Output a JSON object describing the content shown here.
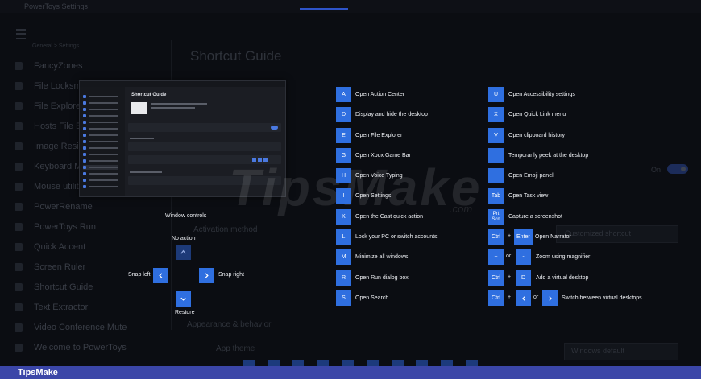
{
  "background": {
    "app_title": "PowerToys Settings",
    "breadcrumb": "General > Settings",
    "nav_items": [
      "FancyZones",
      "File Locksmith",
      "File Explorer add-ons",
      "Hosts File Editor",
      "Image Resizer",
      "Keyboard Manager",
      "Mouse utilities",
      "PowerRename",
      "PowerToys Run",
      "Quick Accent",
      "Screen Ruler",
      "Shortcut Guide",
      "Text Extractor",
      "Video Conference Mute",
      "Welcome to PowerToys"
    ],
    "page_title": "Shortcut Guide",
    "activation_heading": "Activation method",
    "dropdown_value": "Customized shortcut",
    "appearance_heading": "Appearance & behavior",
    "app_theme": "App theme",
    "theme_value": "Windows default",
    "toggle_label": "On"
  },
  "thumbnail": {
    "title": "Shortcut Guide"
  },
  "watermark": {
    "main": "TipsMake",
    "suffix": ".com"
  },
  "window_controls": {
    "heading": "Window controls",
    "no_action": "No action",
    "snap_left": "Snap left",
    "snap_right": "Snap right",
    "restore": "Restore"
  },
  "shortcuts_left": [
    {
      "key": "A",
      "label": "Open Action Center"
    },
    {
      "key": "D",
      "label": "Display and hide the desktop"
    },
    {
      "key": "E",
      "label": "Open File Explorer"
    },
    {
      "key": "G",
      "label": "Open Xbox Game Bar"
    },
    {
      "key": "H",
      "label": "Open Voice Typing"
    },
    {
      "key": "I",
      "label": "Open Settings"
    },
    {
      "key": "K",
      "label": "Open the Cast quick action"
    },
    {
      "key": "L",
      "label": "Lock your PC or switch accounts"
    },
    {
      "key": "M",
      "label": "Minimize all windows"
    },
    {
      "key": "R",
      "label": "Open Run dialog box"
    },
    {
      "key": "S",
      "label": "Open Search"
    }
  ],
  "shortcuts_right": [
    {
      "key": "U",
      "label": "Open Accessibility settings"
    },
    {
      "key": "X",
      "label": "Open Quick Link menu"
    },
    {
      "key": "V",
      "label": "Open clipboard history"
    },
    {
      "key": ",",
      "label": "Temporarily peek at the desktop"
    },
    {
      "key": ";",
      "label": "Open Emoji panel"
    },
    {
      "key": "Tab",
      "label": "Open Task view"
    },
    {
      "key": "Prt Scn",
      "label": "Capture a screenshot"
    }
  ],
  "combo_shortcuts": {
    "narrator": {
      "key1": "Ctrl",
      "plus": "+",
      "key2": "Enter",
      "label": "Open Narrator"
    },
    "magnifier": {
      "key1": "+",
      "or": "or",
      "key2": "-",
      "label": "Zoom using magnifier"
    },
    "virtual_desktop": {
      "key1": "Ctrl",
      "plus": "+",
      "key2": "D",
      "label": "Add a virtual desktop"
    },
    "switch_desktop": {
      "key1": "Ctrl",
      "plus": "+",
      "or": "or",
      "label": "Switch between virtual desktops"
    }
  },
  "footer": {
    "brand": "TipsMake"
  },
  "colors": {
    "key_blue": "#2f6fe0",
    "footer_bar": "#3b46a8",
    "backdrop": "#05070d"
  }
}
